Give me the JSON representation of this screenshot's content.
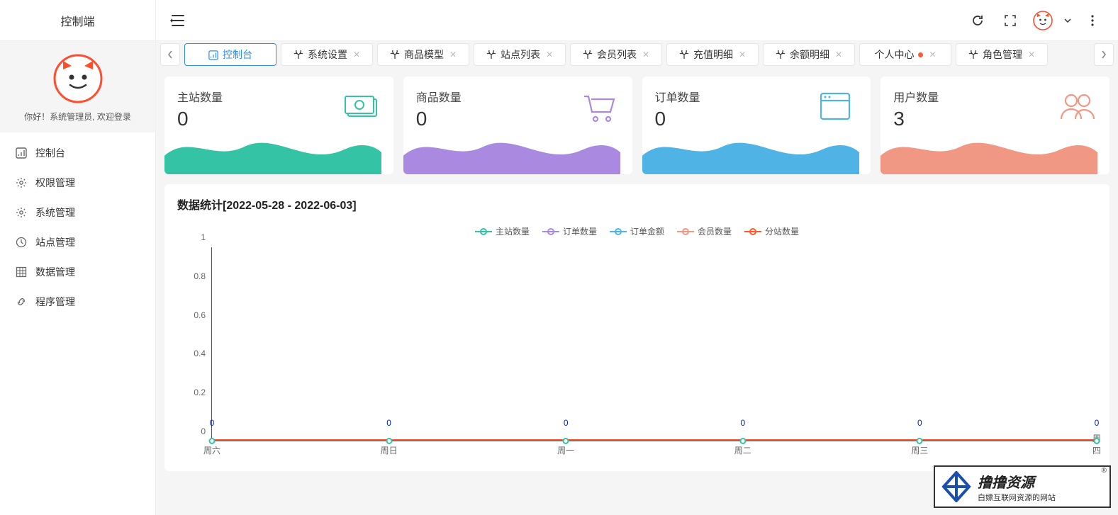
{
  "sidebar": {
    "title": "控制端",
    "welcome": "你好！系统管理员, 欢迎登录",
    "items": [
      {
        "label": "控制台",
        "icon": "dashboard"
      },
      {
        "label": "权限管理",
        "icon": "gear"
      },
      {
        "label": "系统管理",
        "icon": "gear"
      },
      {
        "label": "站点管理",
        "icon": "clock"
      },
      {
        "label": "数据管理",
        "icon": "grid"
      },
      {
        "label": "程序管理",
        "icon": "link"
      }
    ]
  },
  "tabs": [
    {
      "label": "控制台",
      "icon": "dashboard",
      "active": true,
      "closable": false
    },
    {
      "label": "系统设置",
      "icon": "palm",
      "closable": true
    },
    {
      "label": "商品模型",
      "icon": "palm",
      "closable": true
    },
    {
      "label": "站点列表",
      "icon": "palm",
      "closable": true
    },
    {
      "label": "会员列表",
      "icon": "palm",
      "closable": true
    },
    {
      "label": "充值明细",
      "icon": "palm",
      "closable": true
    },
    {
      "label": "余额明细",
      "icon": "palm",
      "closable": true
    },
    {
      "label": "个人中心",
      "dot": true,
      "closable": true
    },
    {
      "label": "角色管理",
      "icon": "palm",
      "closable": true
    }
  ],
  "stats": [
    {
      "label": "主站数量",
      "value": "0",
      "color": "#34c3a4",
      "icon": "money"
    },
    {
      "label": "商品数量",
      "value": "0",
      "color": "#a98ae0",
      "icon": "cart"
    },
    {
      "label": "订单数量",
      "value": "0",
      "color": "#4fb3e6",
      "icon": "window"
    },
    {
      "label": "用户数量",
      "value": "3",
      "color": "#f09884",
      "icon": "users"
    }
  ],
  "chart": {
    "title": "数据统计[2022-05-28 - 2022-06-03]",
    "legend": [
      {
        "label": "主站数量",
        "color": "#34c3a4"
      },
      {
        "label": "订单数量",
        "color": "#a98ae0"
      },
      {
        "label": "订单金额",
        "color": "#4fb3e6"
      },
      {
        "label": "会员数量",
        "color": "#f09884"
      },
      {
        "label": "分站数量",
        "color": "#ff5a2e"
      }
    ]
  },
  "chart_data": {
    "type": "line",
    "categories": [
      "周六",
      "周日",
      "周一",
      "周二",
      "周三",
      "周四"
    ],
    "ylim": [
      0,
      1
    ],
    "yticks": [
      0,
      0.2,
      0.4,
      0.6,
      0.8,
      1
    ],
    "series": [
      {
        "name": "主站数量",
        "values": [
          0,
          0,
          0,
          0,
          0,
          0
        ]
      },
      {
        "name": "订单数量",
        "values": [
          0,
          0,
          0,
          0,
          0,
          0
        ]
      },
      {
        "name": "订单金额",
        "values": [
          0,
          0,
          0,
          0,
          0,
          0
        ]
      },
      {
        "name": "会员数量",
        "values": [
          0,
          0,
          0,
          0,
          0,
          0
        ]
      },
      {
        "name": "分站数量",
        "values": [
          0,
          0,
          0,
          0,
          0,
          0
        ]
      }
    ],
    "date_range": "2022-05-28 - 2022-06-03"
  },
  "watermark": {
    "title": "撸撸资源",
    "subtitle": "白嫖互联网资源的网站"
  }
}
